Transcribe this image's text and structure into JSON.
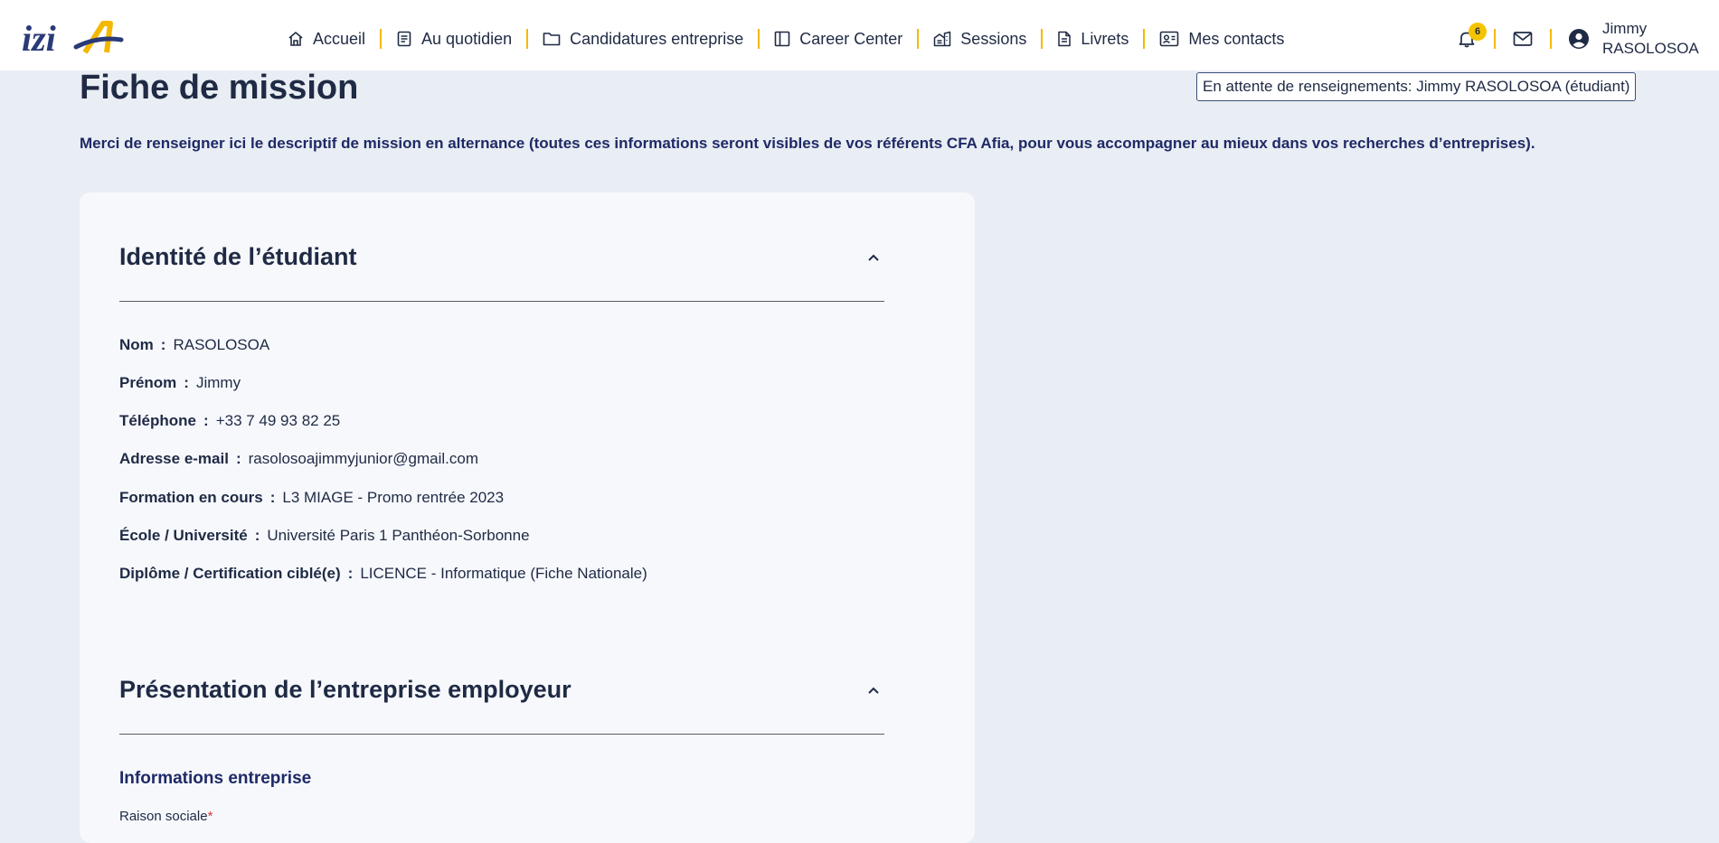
{
  "app": {
    "logo_text": "iziA"
  },
  "nav": {
    "items": [
      {
        "label": "Accueil",
        "icon": "home-icon"
      },
      {
        "label": "Au quotidien",
        "icon": "list-icon"
      },
      {
        "label": "Candidatures entreprise",
        "icon": "folder-icon"
      },
      {
        "label": "Career Center",
        "icon": "panel-icon"
      },
      {
        "label": "Sessions",
        "icon": "building-icon"
      },
      {
        "label": "Livrets",
        "icon": "document-icon"
      },
      {
        "label": "Mes contacts",
        "icon": "contacts-icon"
      }
    ]
  },
  "header_right": {
    "notification_count": "6",
    "user_first": "Jimmy",
    "user_last": "RASOLOSOA"
  },
  "page": {
    "title": "Fiche de mission",
    "status": "En attente de renseignements: Jimmy RASOLOSOA (étudiant)",
    "intro": "Merci de renseigner ici le descriptif de mission en alternance (toutes ces informations seront visibles de vos référents CFA Afia, pour vous accompagner au mieux dans vos recherches d’entreprises)."
  },
  "identity": {
    "title": "Identité de l’étudiant",
    "fields": [
      {
        "label": "Nom",
        "value": "RASOLOSOA"
      },
      {
        "label": "Prénom",
        "value": "Jimmy"
      },
      {
        "label": "Téléphone",
        "value": "+33 7 49 93 82 25"
      },
      {
        "label": "Adresse e-mail",
        "value": "rasolosoajimmyjunior@gmail.com"
      },
      {
        "label": "Formation en cours",
        "value": "L3 MIAGE - Promo rentrée 2023"
      },
      {
        "label": "École / Université",
        "value": "Université Paris 1 Panthéon-Sorbonne"
      },
      {
        "label": "Diplôme / Certification ciblé(e)",
        "value": "LICENCE - Informatique (Fiche Nationale)"
      }
    ]
  },
  "company": {
    "title": "Présentation de l’entreprise employeur",
    "subtitle": "Informations entreprise",
    "raison_sociale_label": "Raison sociale",
    "required_mark": "*"
  },
  "colors": {
    "accent": "#f5b800",
    "text": "#1f2a44",
    "background": "#e9edf4"
  }
}
